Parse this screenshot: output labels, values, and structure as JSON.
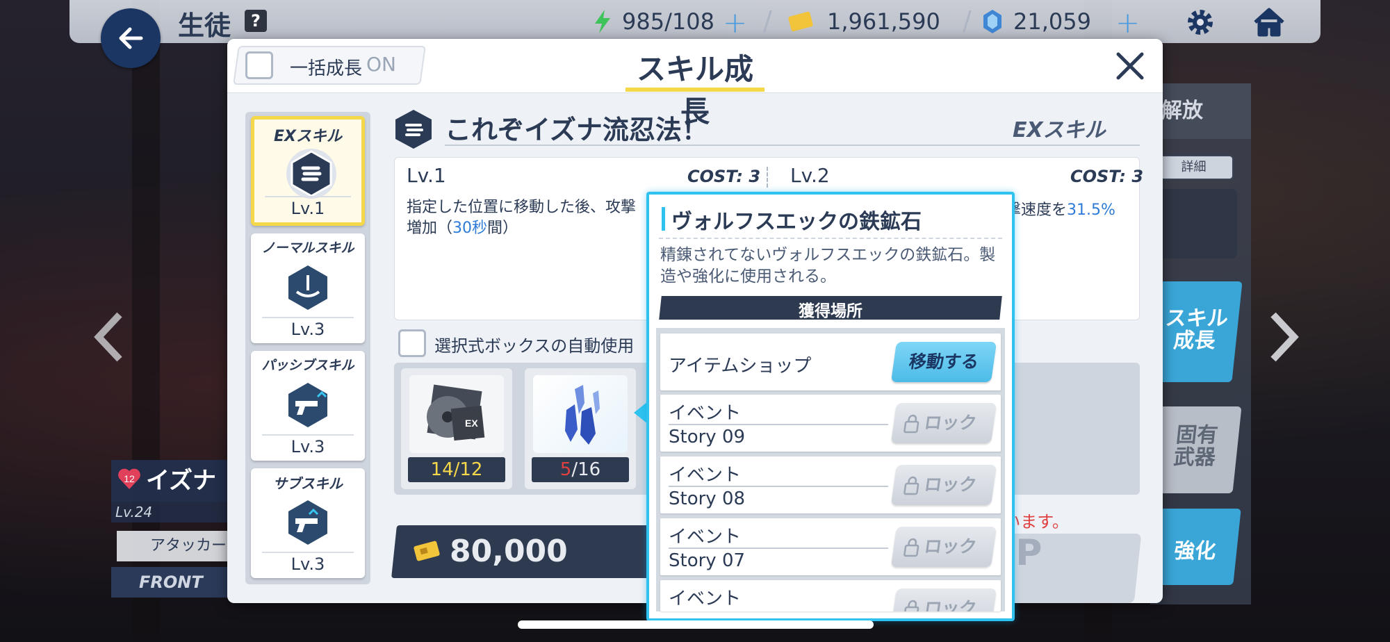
{
  "header": {
    "title": "生徒",
    "help": "?",
    "resources": {
      "ap": "985/108",
      "credits": "1,961,590",
      "pyroxene": "21,059"
    }
  },
  "right_panel": {
    "header": "解放",
    "detail": "詳細",
    "skill_growth": "スキル\n成長",
    "unique_weapon": "固有\n武器",
    "enhance": "強化"
  },
  "character": {
    "name": "イズナ",
    "bond": "12",
    "level": "Lv.24",
    "role": "アタッカー",
    "position": "FRONT"
  },
  "modal": {
    "bulk_label": "一括成長",
    "bulk_state": "ON",
    "title": "スキル成長",
    "tabs": [
      {
        "label": "EXスキル",
        "level": "Lv.1"
      },
      {
        "label": "ノーマルスキル",
        "level": "Lv.3"
      },
      {
        "label": "パッシブスキル",
        "level": "Lv.3"
      },
      {
        "label": "サブスキル",
        "level": "Lv.3"
      }
    ],
    "skill_name": "これぞイズナ流忍法！",
    "skill_type": "EXスキル",
    "lv1": "Lv.1",
    "cost1": "COST: 3",
    "lv2": "Lv.2",
    "cost2": "COST: 3",
    "desc1_a": "指定した位置に移動した後、攻撃",
    "desc1_b": "増加（",
    "desc1_sec": "30秒",
    "desc1_c": "間）",
    "desc2_a": "撃速度を",
    "desc2_pct": "31.5%",
    "auto_use_label": "選択式ボックスの自動使用",
    "materials": [
      {
        "have": "14",
        "need": "/12"
      },
      {
        "have": "5",
        "need": "/16"
      }
    ],
    "cost_value": "80,000",
    "warning": "しています。",
    "up_label": "UP"
  },
  "popup": {
    "title": "ヴォルフスエックの鉄鉱石",
    "description": "精錬されてないヴォルフスエックの鉄鉱石。製造や強化に使用される。",
    "acquisition_header": "獲得場所",
    "sources": [
      {
        "name": "アイテムショップ",
        "button": "移動する"
      },
      {
        "category": "イベント",
        "sub": "Story 09",
        "button": "ロック"
      },
      {
        "category": "イベント",
        "sub": "Story 08",
        "button": "ロック"
      },
      {
        "category": "イベント",
        "sub": "Story 07",
        "button": "ロック"
      },
      {
        "category": "イベント",
        "sub": "",
        "button": "ロック"
      }
    ]
  },
  "colors": {
    "accent_cyan": "#2fc2ef",
    "navy": "#2e3a50",
    "highlight_yellow": "#f4d84a",
    "link_blue": "#2f7bd8",
    "warning_red": "#e04040"
  }
}
